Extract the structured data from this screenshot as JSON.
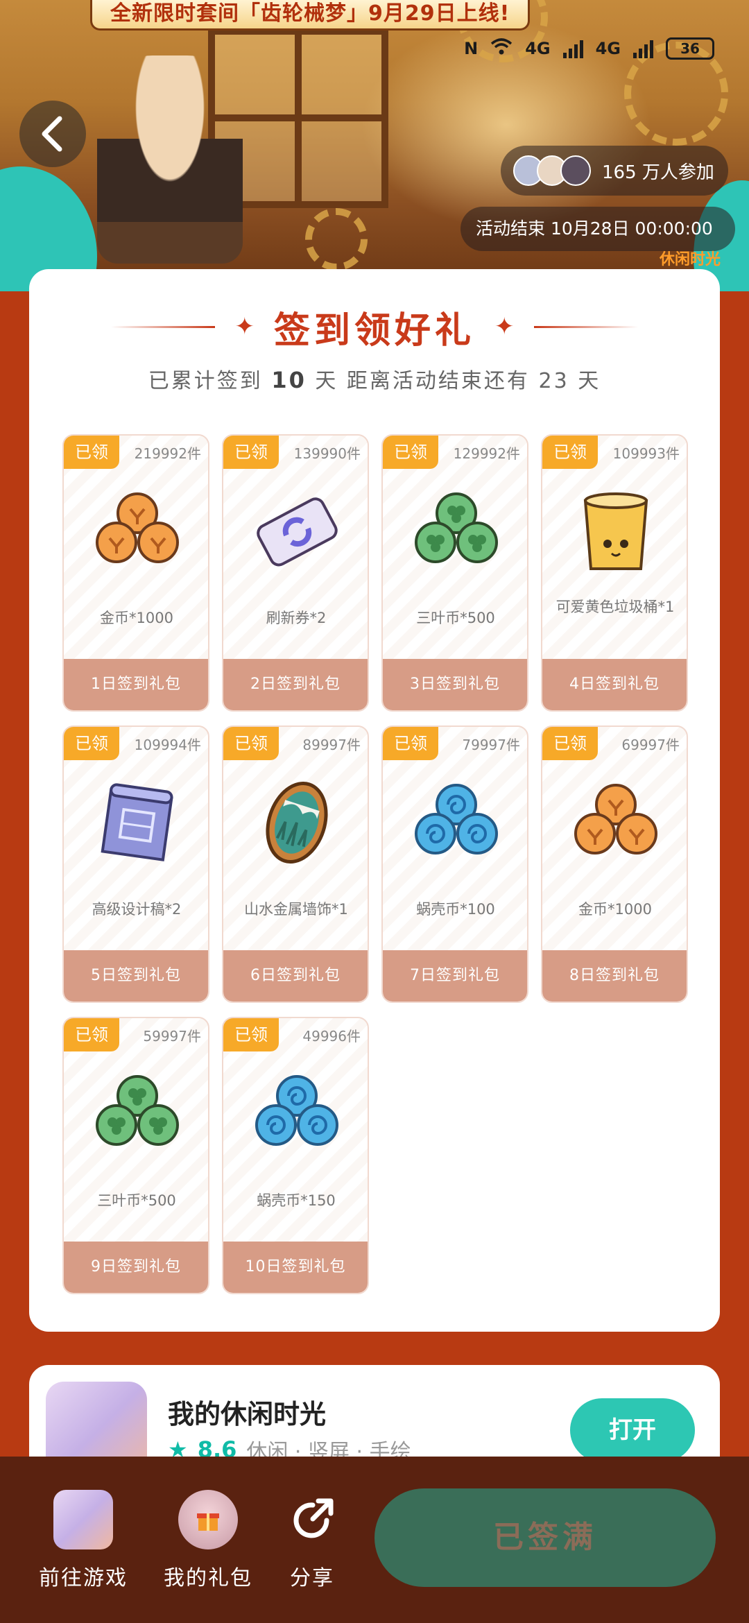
{
  "banner": {
    "notice": "全新限时套间「齿轮械梦」9月29日上线!",
    "participants": "165 万人参加",
    "end_time": "活动结束 10月28日 00:00:00",
    "tag": "休闲时光"
  },
  "status_bar": {
    "network1": "4G",
    "network2": "4G",
    "battery": "36"
  },
  "checkin": {
    "title": "签到领好礼",
    "summary_prefix": "已累计签到",
    "days_signed": "10",
    "summary_mid": "天  距离活动结束还有",
    "days_left": "23",
    "summary_suffix": "天"
  },
  "rewards": [
    {
      "badge": "已领",
      "stock": "219992件",
      "name": "金币*1000",
      "day": "1日签到礼包",
      "icon": "gold-coins"
    },
    {
      "badge": "已领",
      "stock": "139990件",
      "name": "刷新券*2",
      "day": "2日签到礼包",
      "icon": "refresh-ticket"
    },
    {
      "badge": "已领",
      "stock": "129992件",
      "name": "三叶币*500",
      "day": "3日签到礼包",
      "icon": "clover-coins"
    },
    {
      "badge": "已领",
      "stock": "109993件",
      "name": "可爱黄色垃圾桶*1",
      "day": "4日签到礼包",
      "icon": "yellow-trash-can"
    },
    {
      "badge": "已领",
      "stock": "109994件",
      "name": "高级设计稿*2",
      "day": "5日签到礼包",
      "icon": "blueprint"
    },
    {
      "badge": "已领",
      "stock": "89997件",
      "name": "山水金属墙饰*1",
      "day": "6日签到礼包",
      "icon": "wall-decoration"
    },
    {
      "badge": "已领",
      "stock": "79997件",
      "name": "蜗壳币*100",
      "day": "7日签到礼包",
      "icon": "shell-coins"
    },
    {
      "badge": "已领",
      "stock": "69997件",
      "name": "金币*1000",
      "day": "8日签到礼包",
      "icon": "gold-coins"
    },
    {
      "badge": "已领",
      "stock": "59997件",
      "name": "三叶币*500",
      "day": "9日签到礼包",
      "icon": "clover-coins"
    },
    {
      "badge": "已领",
      "stock": "49996件",
      "name": "蜗壳币*150",
      "day": "10日签到礼包",
      "icon": "shell-coins"
    }
  ],
  "game": {
    "title": "我的休闲时光",
    "score": "8.6",
    "tags": "休闲 · 竖屏 · 手绘",
    "open_label": "打开"
  },
  "bottom_bar": {
    "go_game": "前往游戏",
    "my_gifts": "我的礼包",
    "share": "分享",
    "signed_label": "已签满"
  },
  "colors": {
    "page_bg": "#b83a12",
    "accent_red": "#c93a1a",
    "badge_orange": "#f7a928",
    "footer_salmon": "#d79c86",
    "teal": "#2dc7b3",
    "bottom_bar": "#5a2210",
    "signed_button": "#3a6e58"
  }
}
